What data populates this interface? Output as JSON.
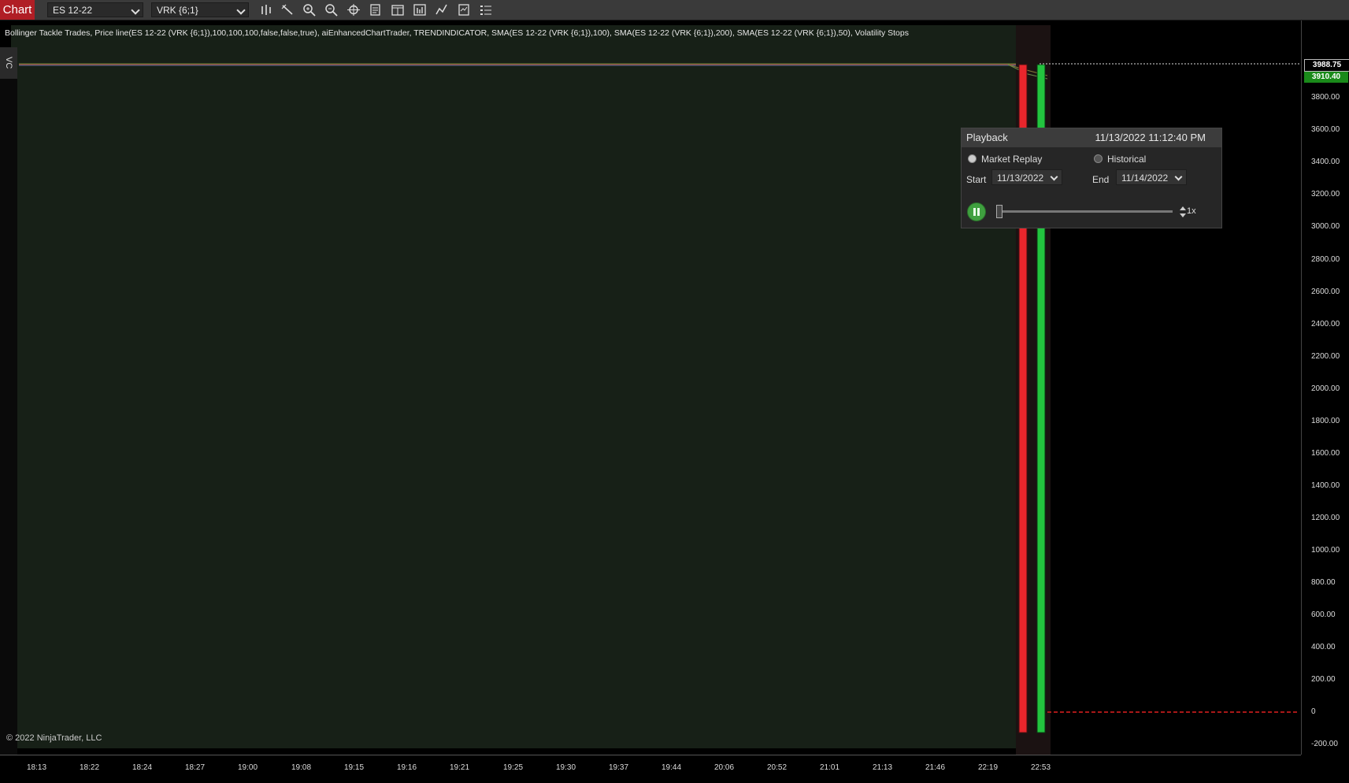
{
  "toolbar": {
    "chart_tab": "Chart",
    "instrument": "ES 12-22",
    "bar_type": "VRK {6;1}",
    "icons": [
      "bars-type-icon",
      "draw-tool-icon",
      "zoom-in-icon",
      "zoom-out-icon",
      "crosshair-icon",
      "data-box-icon",
      "chart-trader-icon",
      "strategies-icon",
      "indicators-icon",
      "properties-icon",
      "templates-icon"
    ]
  },
  "chart": {
    "indicator_line": "Bollinger Tackle Trades, Price line(ES 12-22 (VRK {6;1}),100,100,100,false,false,true), aiEnhancedChartTrader, TRENDINDICATOR, SMA(ES 12-22 (VRK {6;1}),100), SMA(ES 12-22 (VRK {6;1}),200), SMA(ES 12-22 (VRK {6;1}),50), Volatility Stops",
    "vc_tab": "VC",
    "copyright": "© 2022 NinjaTrader, LLC",
    "colors": {
      "plot_bg": "#172017",
      "bear_bar": "#e8262c",
      "bull_bar": "#23c43f",
      "stop_line": "#e02020"
    }
  },
  "price_axis": {
    "labels": [
      "3800.00",
      "3600.00",
      "3400.00",
      "3200.00",
      "3000.00",
      "2800.00",
      "2600.00",
      "2400.00",
      "2200.00",
      "2000.00",
      "1800.00",
      "1600.00",
      "1400.00",
      "1200.00",
      "1000.00",
      "800.00",
      "600.00",
      "400.00",
      "200.00",
      "0",
      "-200.00"
    ],
    "last_price": "3988.75",
    "stop_price": "3910.40"
  },
  "time_axis": {
    "labels": [
      "18:13",
      "18:22",
      "18:24",
      "18:27",
      "19:00",
      "19:08",
      "19:15",
      "19:16",
      "19:21",
      "19:25",
      "19:30",
      "19:37",
      "19:44",
      "20:06",
      "20:52",
      "21:01",
      "21:13",
      "21:46",
      "22:19",
      "22:53"
    ]
  },
  "playback": {
    "title": "Playback",
    "datetime": "11/13/2022 11:12:40 PM",
    "mode_market_replay": "Market Replay",
    "mode_historical": "Historical",
    "start_label": "Start",
    "start_date": "11/13/2022",
    "end_label": "End",
    "end_date": "11/14/2022",
    "speed": "1x",
    "slider_position": 0.02
  }
}
